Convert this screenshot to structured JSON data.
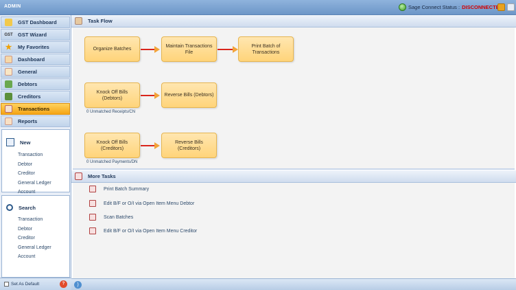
{
  "app": {
    "title": "ADMIN",
    "sage_label": "Sage Connect Status :",
    "sage_status": "DISCONNECTED",
    "colors": {
      "accent": "#f5a415",
      "status": "#d40000"
    }
  },
  "sidebar": {
    "items": [
      {
        "label": "GST Dashboard",
        "icon": "gst-dashboard-icon"
      },
      {
        "label": "GST Wizard",
        "icon": "gst-wizard-icon",
        "glyph": "GST"
      },
      {
        "label": "My Favorites",
        "icon": "star-icon"
      },
      {
        "label": "Dashboard",
        "icon": "dashboard-icon"
      },
      {
        "label": "General",
        "icon": "general-icon"
      },
      {
        "label": "Debtors",
        "icon": "debtors-icon"
      },
      {
        "label": "Creditors",
        "icon": "creditors-icon"
      },
      {
        "label": "Transactions",
        "icon": "transactions-icon",
        "active": true
      },
      {
        "label": "Reports",
        "icon": "reports-icon"
      }
    ],
    "new": {
      "title": "New",
      "links": [
        "Transaction",
        "Debtor",
        "Creditor",
        "General Ledger Account"
      ]
    },
    "search": {
      "title": "Search",
      "links": [
        "Transaction",
        "Debtor",
        "Creditor",
        "General Ledger Account"
      ]
    },
    "set_default": "Set As Default"
  },
  "taskflow": {
    "title": "Task Flow",
    "nodes": [
      "Organize Batches",
      "Maintain Transactions File",
      "Print Batch of Transactions",
      "Knock Off Bills (Debtors)",
      "Reverse Bills (Debtors)",
      "Knock Off Bills (Creditors)",
      "Reverse Bills (Creditors)"
    ],
    "notes": [
      "0 Unmatched Receipts/CN",
      "0 Unmatched Payments/DN"
    ]
  },
  "more_tasks": {
    "title": "More Tasks",
    "items": [
      "Print Batch Summary",
      "Edit B/F or O/I via Open Item Menu Debtor",
      "Scan Batches",
      "Edit B/F or O/I via Open Item Menu Creditor"
    ]
  }
}
